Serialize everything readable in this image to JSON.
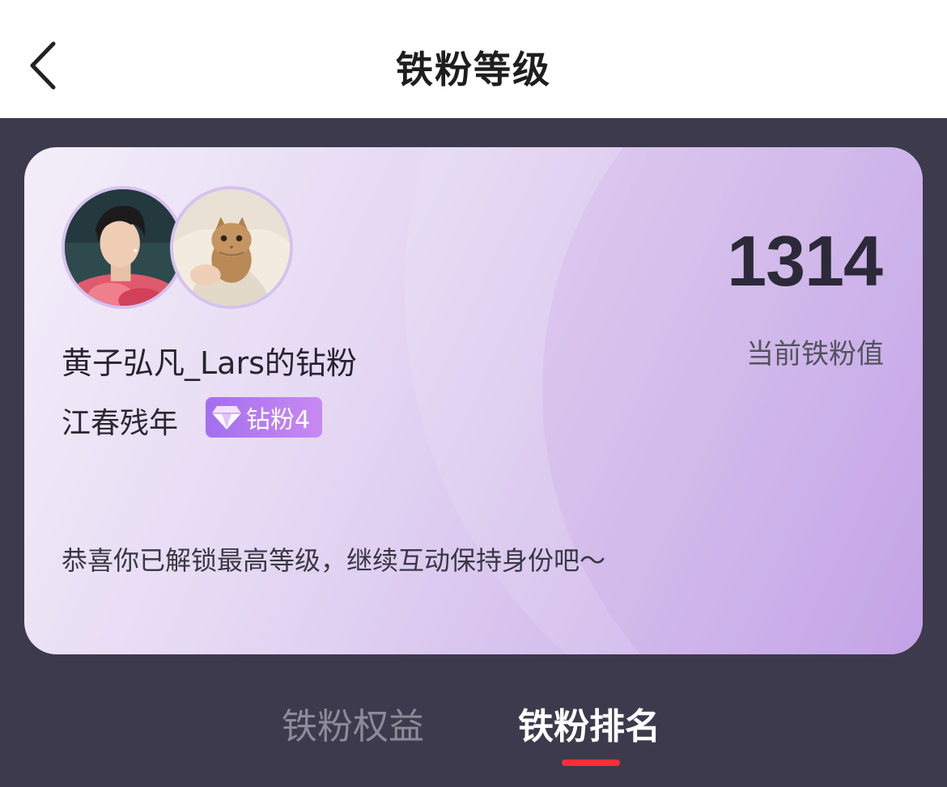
{
  "header": {
    "title": "铁粉等级",
    "back_icon": "chevron-left-icon"
  },
  "card": {
    "fan_value": "1314",
    "fan_value_label": "当前铁粉值",
    "username": "黄子弘凡_Lars的钻粉",
    "nickname": "江春残年",
    "badge": {
      "icon": "diamond-icon",
      "label": "钻粉4"
    },
    "message": "恭喜你已解锁最高等级，继续互动保持身份吧～",
    "avatars": [
      "singer-avatar",
      "user-cat-avatar"
    ]
  },
  "tabs": [
    {
      "label": "铁粉权益",
      "active": false
    },
    {
      "label": "铁粉排名",
      "active": true
    }
  ],
  "colors": {
    "accent": "#ff2c3c",
    "background": "#3d3a4e",
    "card_gradient_start": "#f4eef9",
    "card_gradient_end": "#c19fe6",
    "badge_start": "#a36ff0",
    "badge_end": "#c989f2"
  }
}
